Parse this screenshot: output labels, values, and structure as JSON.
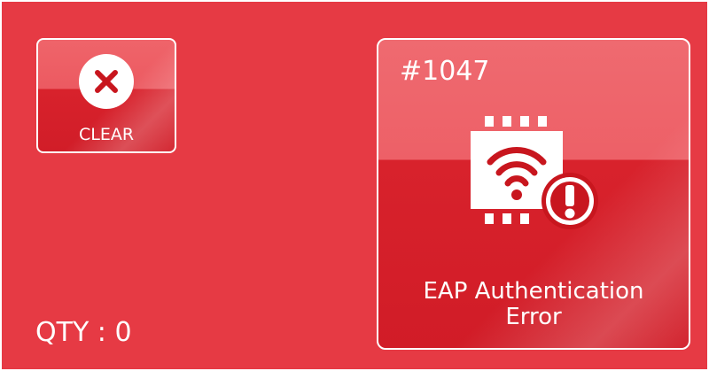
{
  "clear_button": {
    "label": "CLEAR",
    "icon": "close-icon"
  },
  "qty": {
    "text": "QTY : 0"
  },
  "error_tile": {
    "code": "#1047",
    "title_line1": "EAP Authentication",
    "title_line2": "Error",
    "icon": "wifi-chip-warning-icon"
  },
  "colors": {
    "background": "#e63a44",
    "tile_top": "#ed6067",
    "tile_bottom": "#d8222c",
    "icon_red": "#c8161e",
    "foreground": "#ffffff"
  }
}
